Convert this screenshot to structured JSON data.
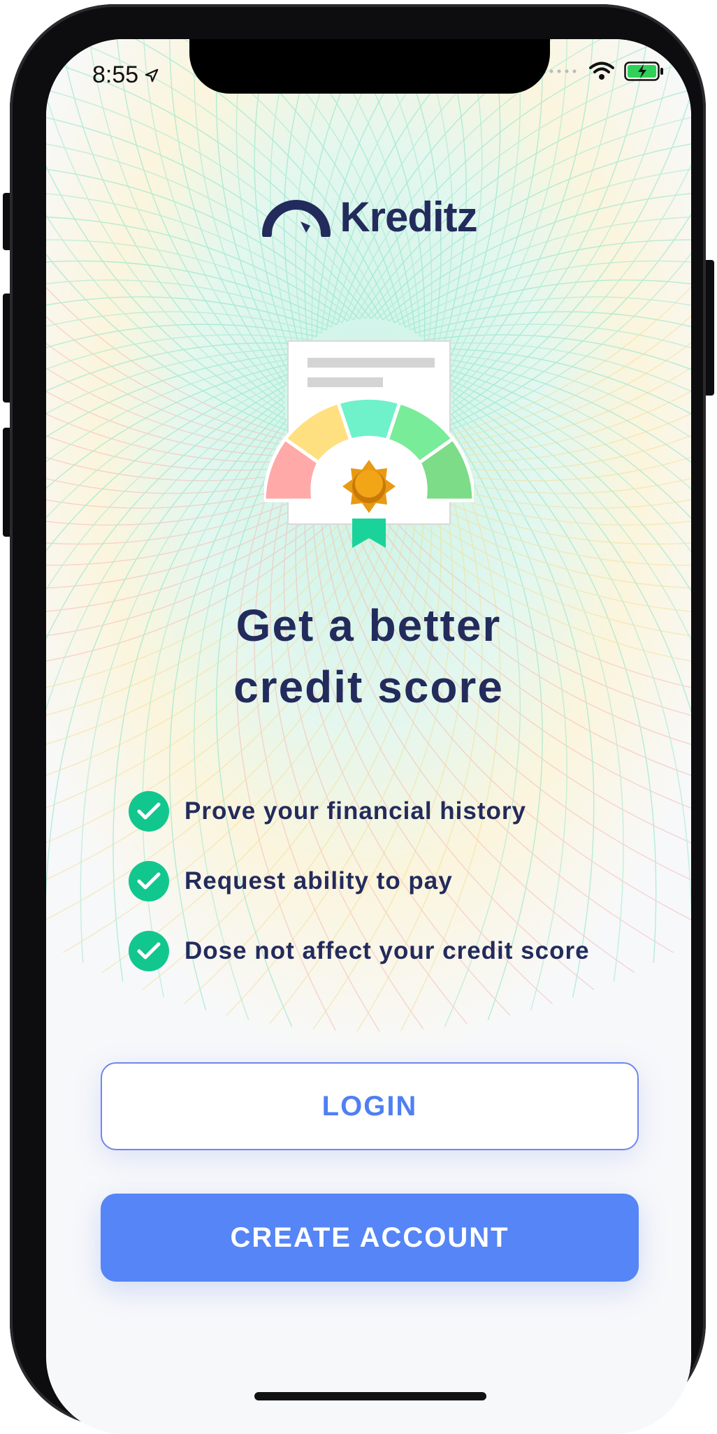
{
  "status_bar": {
    "time": "8:55",
    "location_icon": "location-arrow-icon",
    "signal_icon": "cellular-dots-icon",
    "wifi_icon": "wifi-icon",
    "battery_icon": "battery-charging-icon"
  },
  "brand": {
    "name": "Kreditz",
    "logo_icon": "gauge-arc-icon",
    "primary_color": "#232b5c",
    "accent_color": "#12c78e",
    "button_color": "#5585f6"
  },
  "hero": {
    "illustration": "credit-score-certificate-icon",
    "headline_line1": "Get a better",
    "headline_line2": "credit score"
  },
  "features": [
    {
      "icon": "check-circle-icon",
      "label": "Prove your financial history"
    },
    {
      "icon": "check-circle-icon",
      "label": "Request ability to pay"
    },
    {
      "icon": "check-circle-icon",
      "label": "Dose not affect your credit score"
    }
  ],
  "actions": {
    "login_label": "LOGIN",
    "create_account_label": "CREATE ACCOUNT"
  }
}
